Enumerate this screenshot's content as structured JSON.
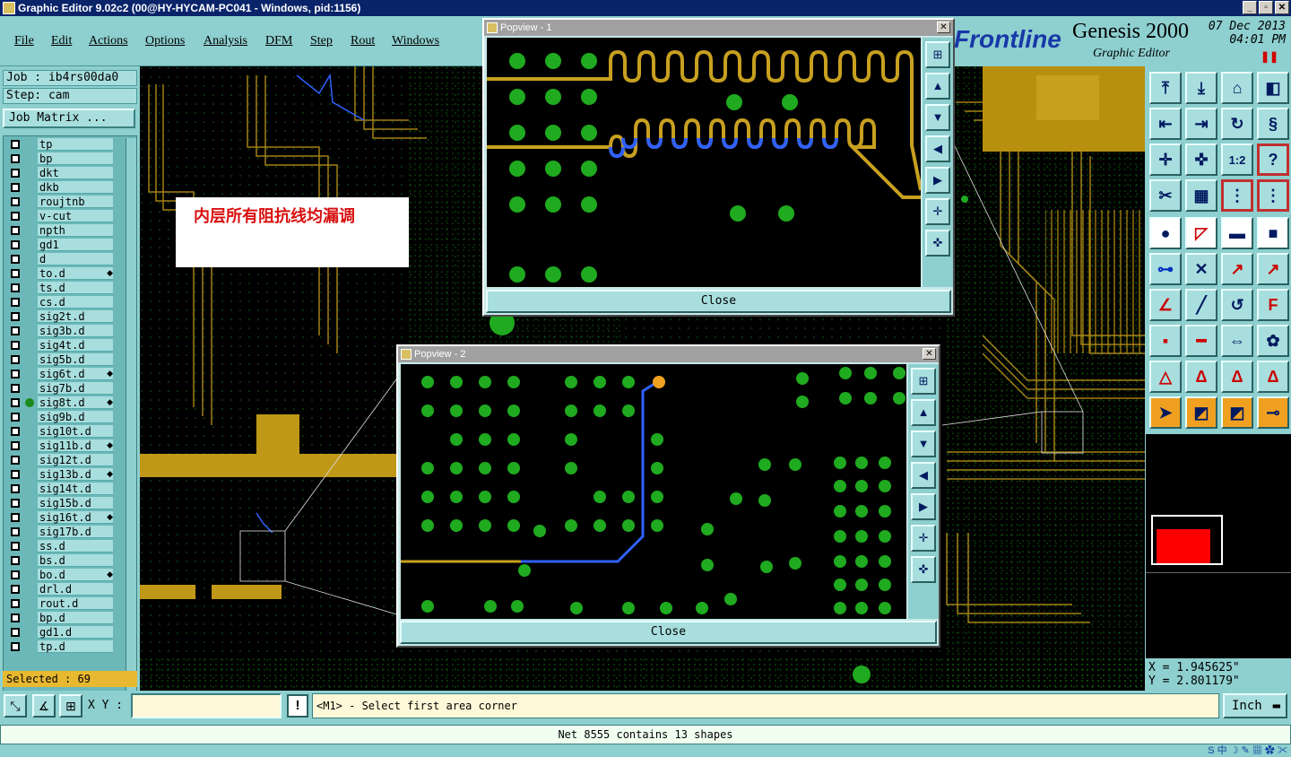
{
  "window": {
    "title": "Graphic Editor 9.02c2 (00@HY-HYCAM-PC041 - Windows, pid:1156)",
    "btn_min": "_",
    "btn_max": "▫",
    "btn_close": "✕"
  },
  "menu": {
    "file": "File",
    "edit": "Edit",
    "actions": "Actions",
    "options": "Options",
    "analysis": "Analysis",
    "dfm": "DFM",
    "step": "Step",
    "rout": "Rout",
    "windows": "Windows"
  },
  "brand": {
    "logo": "Frontline",
    "product": "Genesis 2000",
    "subtitle": "Graphic Editor",
    "date": "07 Dec 2013",
    "time": "04:01 PM"
  },
  "job": {
    "job_label": "Job : ib4rs00da0",
    "step_label": "Step: cam",
    "matrix_button": "Job Matrix ..."
  },
  "layers": [
    {
      "name": "tp"
    },
    {
      "name": "bp"
    },
    {
      "name": "dkt"
    },
    {
      "name": "dkb"
    },
    {
      "name": "roujtnb"
    },
    {
      "name": "v-cut"
    },
    {
      "name": "npth"
    },
    {
      "name": "gd1"
    },
    {
      "name": "d"
    },
    {
      "name": "to.d",
      "arrow": true
    },
    {
      "name": "ts.d"
    },
    {
      "name": "cs.d"
    },
    {
      "name": "sig2t.d"
    },
    {
      "name": "sig3b.d"
    },
    {
      "name": "sig4t.d"
    },
    {
      "name": "sig5b.d"
    },
    {
      "name": "sig6t.d",
      "arrow": true
    },
    {
      "name": "sig7b.d"
    },
    {
      "name": "sig8t.d",
      "arrow": true,
      "active": true
    },
    {
      "name": "sig9b.d"
    },
    {
      "name": "sig10t.d"
    },
    {
      "name": "sig11b.d",
      "arrow": true
    },
    {
      "name": "sig12t.d"
    },
    {
      "name": "sig13b.d",
      "arrow": true
    },
    {
      "name": "sig14t.d"
    },
    {
      "name": "sig15b.d"
    },
    {
      "name": "sig16t.d",
      "arrow": true
    },
    {
      "name": "sig17b.d"
    },
    {
      "name": "ss.d"
    },
    {
      "name": "bs.d"
    },
    {
      "name": "bo.d",
      "arrow": true
    },
    {
      "name": "drl.d"
    },
    {
      "name": "rout.d"
    },
    {
      "name": "bp.d"
    },
    {
      "name": "gd1.d"
    },
    {
      "name": "tp.d"
    }
  ],
  "selected": "Selected : 69",
  "annotation": "内层所有阻抗线均漏调",
  "popview1": {
    "title": "Popview - 1",
    "close": "Close"
  },
  "popview2": {
    "title": "Popview - 2",
    "close": "Close"
  },
  "coords": {
    "x": "X = 1.945625\"",
    "y": "Y = 2.801179\""
  },
  "bottom": {
    "xy_label": "X Y :",
    "xy_value": "",
    "prompt": "<M1> - Select first area corner",
    "unit": "Inch",
    "status": "Net 8555 contains 13 shapes"
  },
  "toolbar": {
    "btn_1to2": "1:2",
    "btn_help": "?"
  },
  "colors": {
    "panel": "#8ecfcf",
    "copper": "#c8a020",
    "pad": "#1faa1f",
    "trace_selected": "#3060ff",
    "highlight": "#f0a020"
  }
}
